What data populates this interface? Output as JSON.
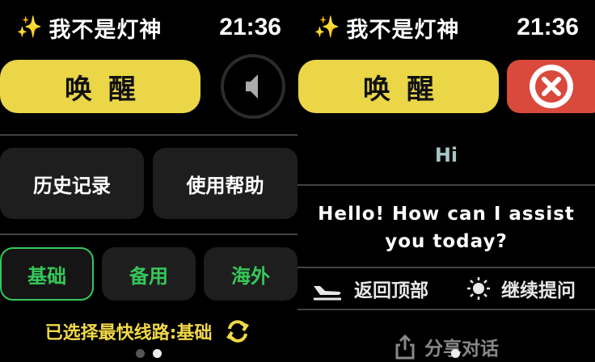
{
  "header": {
    "sparkle": "✨",
    "title": "我不是灯神",
    "time": "21:36"
  },
  "left": {
    "wake_label": "唤醒",
    "history_label": "历史记录",
    "help_label": "使用帮助",
    "routes": [
      "基础",
      "备用",
      "海外"
    ],
    "selected_route": "基础",
    "status_text": "已选择最快线路:基础"
  },
  "right": {
    "wake_label": "唤醒",
    "user_message": "Hi",
    "assistant_message": "Hello! How can I assist you today?",
    "back_to_top_label": "返回顶部",
    "continue_label": "继续提问",
    "share_label": "分享对话"
  },
  "colors": {
    "accent_yellow": "#ead647",
    "route_green": "#35c759",
    "close_red": "#d94a3d"
  },
  "icons": {
    "speaker": "speaker-icon",
    "refresh": "refresh-icon",
    "close": "close-icon",
    "plane": "airplane-icon",
    "sun": "sun-icon",
    "share": "share-icon"
  }
}
